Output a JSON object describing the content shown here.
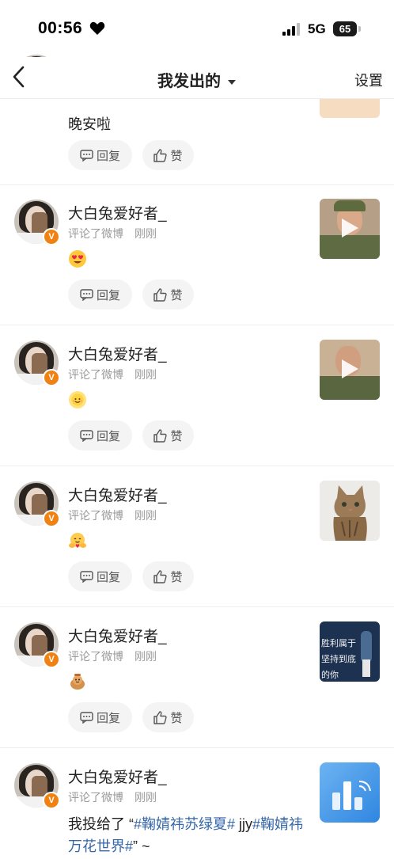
{
  "status_bar": {
    "time": "00:56",
    "network": "5G",
    "battery": "65"
  },
  "nav": {
    "title": "我发出的",
    "settings_label": "设置"
  },
  "colors": {
    "verified_badge": "#f08214",
    "link": "#3667a8",
    "meta": "#9a9a9a"
  },
  "first_partial": {
    "content": "晚安啦",
    "reply_label": "回复",
    "like_label": "赞"
  },
  "items": [
    {
      "username": "大白兔爱好者_",
      "action": "评论了微博",
      "time": "刚刚",
      "emoji": "heart-eyes-emoji",
      "thumbnail": "video-officer-portrait",
      "reply_label": "回复",
      "like_label": "赞"
    },
    {
      "username": "大白兔爱好者_",
      "action": "评论了微博",
      "time": "刚刚",
      "emoji": "sun-face-emoji",
      "thumbnail": "video-officer-portrait",
      "reply_label": "回复",
      "like_label": "赞"
    },
    {
      "username": "大白兔爱好者_",
      "action": "评论了微博",
      "time": "刚刚",
      "emoji": "hug-emoji",
      "thumbnail": "cat-photo",
      "reply_label": "回复",
      "like_label": "赞"
    },
    {
      "username": "大白兔爱好者_",
      "action": "评论了微博",
      "time": "刚刚",
      "emoji": "cheer-emoji",
      "thumbnail": "tennis-poster",
      "thumbnail_text": "胜利属于坚持到底的你",
      "reply_label": "回复",
      "like_label": "赞"
    },
    {
      "username": "大白兔爱好者_",
      "action": "评论了微博",
      "time": "刚刚",
      "content_prefix": "我投给了 “",
      "content_tag1": "#鞠婧祎苏绿夏#",
      "content_mid": " jjy",
      "content_tag2": "#鞠婧祎万花世界#",
      "content_suffix": "” ~",
      "thumbnail": "chart-app-icon"
    }
  ]
}
